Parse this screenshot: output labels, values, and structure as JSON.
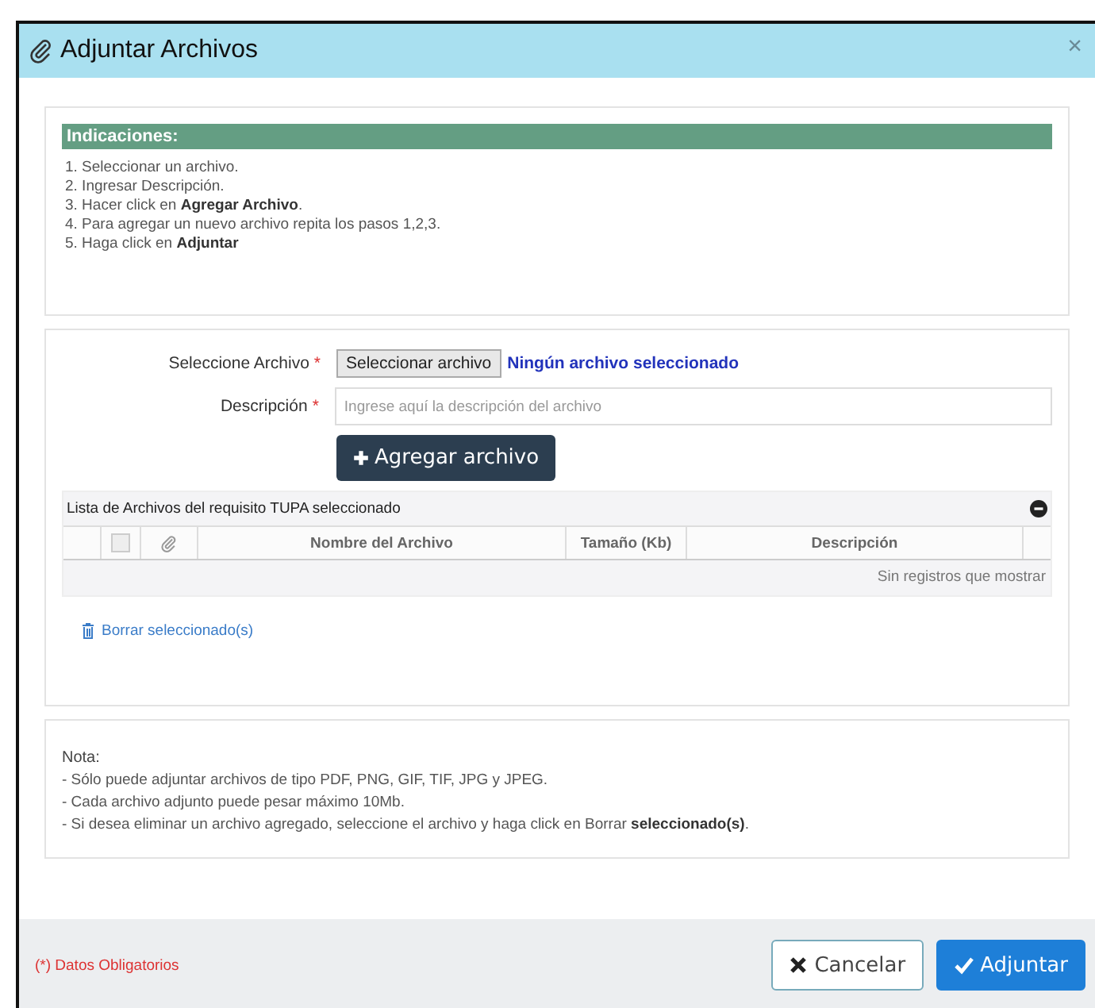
{
  "modal": {
    "title": "Adjuntar Archivos",
    "close": "×"
  },
  "indications": {
    "title": "Indicaciones:",
    "steps": [
      "1. Seleccionar un archivo.",
      "2. Ingresar Descripción.",
      "3. Hacer click en **Agregar Archivo**.",
      "4. Para agregar un nuevo archivo repita los pasos 1,2,3.",
      "5. Haga click en **Adjuntar**"
    ]
  },
  "form": {
    "file_label": "Seleccione Archivo",
    "file_button": "Seleccionar archivo",
    "file_status": "Ningún archivo seleccionado",
    "description_label": "Descripción",
    "required_mark": "*",
    "description_placeholder": "Ingrese aquí la descripción del archivo",
    "add_button": "Agregar archivo"
  },
  "table": {
    "caption": "Lista de Archivos del requisito TUPA seleccionado",
    "select_all": {
      "checked": false
    },
    "columns": [
      "Nombre del Archivo",
      "Tamaño (Kb)",
      "Descripción"
    ],
    "empty_message": "Sin registros que mostrar"
  },
  "delete_link": "Borrar seleccionado(s)",
  "note": {
    "title": "Nota:",
    "lines": [
      "- Sólo puede adjuntar archivos de tipo PDF, PNG, GIF, TIF, JPG y JPEG.",
      "- Cada archivo adjunto puede pesar máximo 10Mb.",
      "- Si desea eliminar un archivo agregado, seleccione el archivo y haga click en Borrar **seleccionado(s)**."
    ]
  },
  "footer": {
    "required_note": "(*) Datos Obligatorios",
    "buttons": [
      {
        "kind": "cancel",
        "label": "Cancelar"
      },
      {
        "kind": "primary",
        "label": "Adjuntar"
      }
    ]
  }
}
